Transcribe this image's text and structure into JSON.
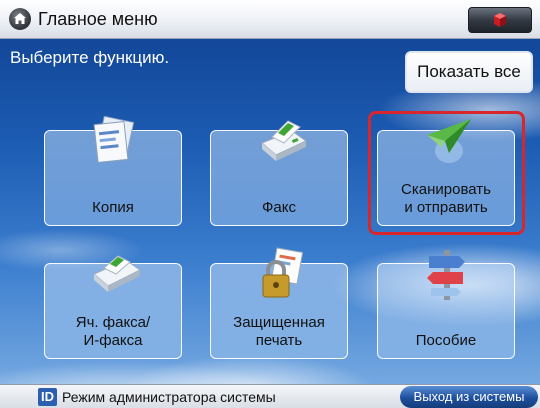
{
  "header": {
    "title": "Главное меню",
    "home_icon": "home-icon",
    "right_button_icon": "settings-cube-icon"
  },
  "main": {
    "prompt": "Выберите функцию.",
    "show_all_label": "Показать все",
    "tiles": [
      {
        "label": "Копия",
        "icon": "copy-icon"
      },
      {
        "label": "Факс",
        "icon": "fax-icon"
      },
      {
        "label": "Сканировать\nи отправить",
        "icon": "paper-plane-icon",
        "highlighted": true
      },
      {
        "label": "Яч. факса/\nИ-факса",
        "icon": "fax-inbox-icon"
      },
      {
        "label": "Защищенная\nпечать",
        "icon": "padlock-icon"
      },
      {
        "label": "Пособие",
        "icon": "signpost-icon"
      }
    ]
  },
  "status": {
    "id_badge": "ID",
    "admin_mode": "Режим администратора системы",
    "logout_label": "Выход из системы"
  },
  "colors": {
    "highlight": "#d9262c",
    "sky_top": "#0f3f8f",
    "logout_button": "#1e4f9c"
  }
}
